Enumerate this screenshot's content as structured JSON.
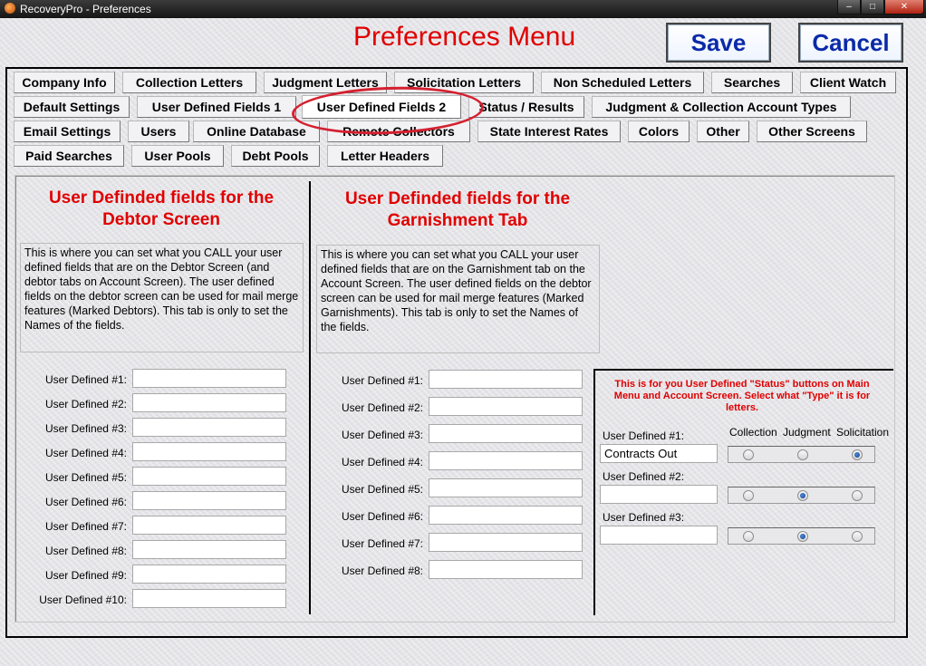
{
  "window": {
    "title": "RecoveryPro - Preferences"
  },
  "header": {
    "heading": "Preferences Menu",
    "save_label": "Save",
    "cancel_label": "Cancel"
  },
  "tabs": {
    "row1": [
      "Company Info",
      "Collection Letters",
      "Judgment Letters",
      "Solicitation Letters",
      "Non Scheduled Letters",
      "Searches",
      "Client Watch"
    ],
    "row2": [
      "Default Settings",
      "User Defined Fields 1",
      "User Defined Fields 2",
      "Status / Results",
      "Judgment & Collection Account Types"
    ],
    "row3": [
      "Email Settings",
      "Users",
      "Online Database",
      "Remote Collectors",
      "State Interest Rates",
      "Colors",
      "Other",
      "Other Screens"
    ],
    "row4": [
      "Paid Searches",
      "User Pools",
      "Debt Pools",
      "Letter Headers"
    ],
    "active": "User Defined Fields 2"
  },
  "debtor": {
    "title": "User Definded fields for the Debtor Screen",
    "description": "This is where you can set what you CALL your user defined fields that are on the Debtor Screen (and debtor tabs on Account Screen). The user defined fields on the debtor screen can be used for mail merge features (Marked Debtors). This tab is only to set the Names of the fields.",
    "fields": [
      {
        "label": "User Defined #1:",
        "value": ""
      },
      {
        "label": "User Defined #2:",
        "value": ""
      },
      {
        "label": "User Defined #3:",
        "value": ""
      },
      {
        "label": "User Defined #4:",
        "value": ""
      },
      {
        "label": "User Defined #5:",
        "value": ""
      },
      {
        "label": "User Defined #6:",
        "value": ""
      },
      {
        "label": "User Defined #7:",
        "value": ""
      },
      {
        "label": "User Defined #8:",
        "value": ""
      },
      {
        "label": "User Defined #9:",
        "value": ""
      },
      {
        "label": "User Defined #10:",
        "value": ""
      }
    ]
  },
  "garnishment": {
    "title": "User Definded fields for the Garnishment Tab",
    "description": "This is where you can set what you CALL your user defined fields that are on the Garnishment tab on the Account Screen. The user defined fields on the debtor screen can be used for mail merge features (Marked Garnishments). This tab is only to set the Names of the fields.",
    "fields": [
      {
        "label": "User Defined #1:",
        "value": ""
      },
      {
        "label": "User Defined #2:",
        "value": ""
      },
      {
        "label": "User Defined #3:",
        "value": ""
      },
      {
        "label": "User Defined #4:",
        "value": ""
      },
      {
        "label": "User Defined #5:",
        "value": ""
      },
      {
        "label": "User Defined #6:",
        "value": ""
      },
      {
        "label": "User Defined #7:",
        "value": ""
      },
      {
        "label": "User Defined #8:",
        "value": ""
      }
    ]
  },
  "status": {
    "title": "This is for you User Defined \"Status\" buttons on Main Menu and Account Screen. Select what \"Type\" it is for letters.",
    "columns": [
      "Collection",
      "Judgment",
      "Solicitation"
    ],
    "rows": [
      {
        "label": "User Defined #1:",
        "value": "Contracts Out",
        "selected": "Solicitation"
      },
      {
        "label": "User Defined #2:",
        "value": "",
        "selected": "Judgment"
      },
      {
        "label": "User Defined #3:",
        "value": "",
        "selected": "Judgment"
      }
    ]
  },
  "colors": {
    "accent_red": "#e00000",
    "button_text": "#0a2aa8",
    "annotation": "#d42030"
  }
}
